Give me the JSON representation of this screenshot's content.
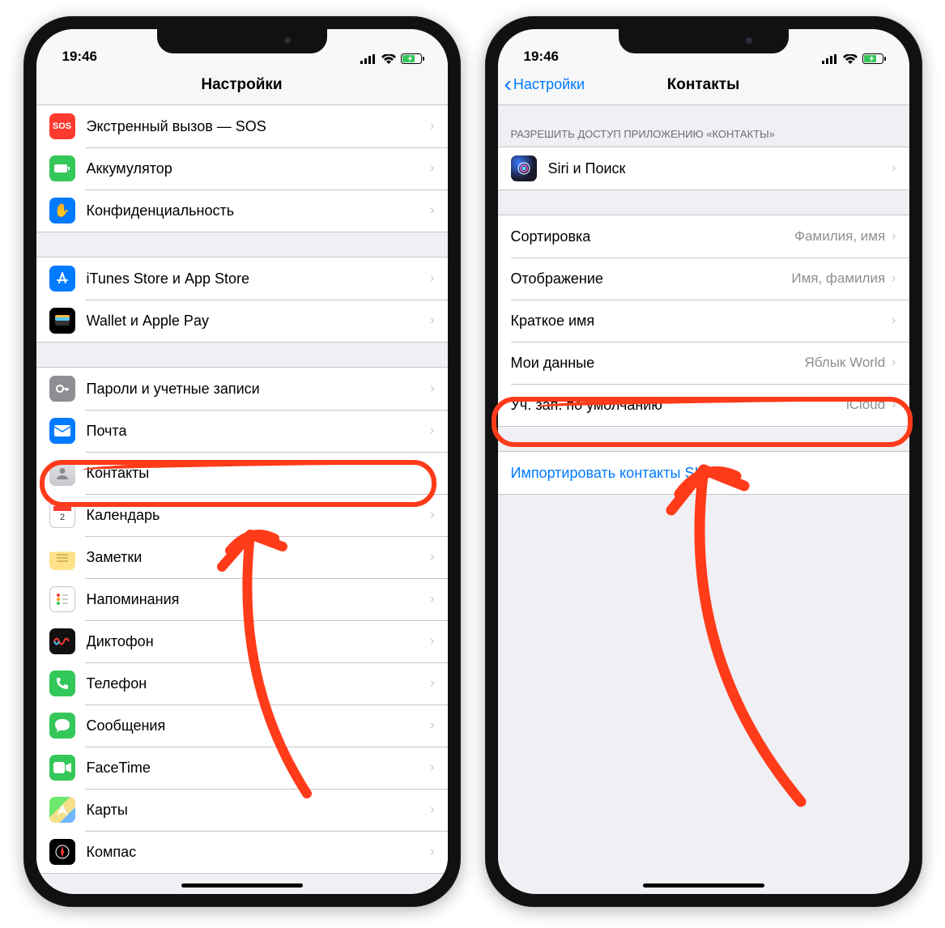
{
  "status": {
    "time": "19:46"
  },
  "left": {
    "title": "Настройки",
    "rows": [
      {
        "icon": "sos-icon",
        "bg": "bg-red",
        "glyph": "SOS",
        "label": "Экстренный вызов — SOS"
      },
      {
        "icon": "battery-app-icon",
        "bg": "bg-green",
        "glyph": "▭",
        "label": "Аккумулятор"
      },
      {
        "icon": "privacy-icon",
        "bg": "bg-blue",
        "glyph": "✋",
        "label": "Конфиденциальность"
      }
    ],
    "rows2": [
      {
        "icon": "appstore-icon",
        "bg": "bg-blue",
        "glyph": "A",
        "label": "iTunes Store и App Store"
      },
      {
        "icon": "wallet-icon",
        "bg": "bg-black",
        "glyph": "▭",
        "label": "Wallet и Apple Pay"
      }
    ],
    "rows3": [
      {
        "icon": "passwords-icon",
        "bg": "bg-gray",
        "glyph": "⚿",
        "label": "Пароли и учетные записи"
      },
      {
        "icon": "mail-icon",
        "bg": "bg-blue",
        "glyph": "✉",
        "label": "Почта"
      },
      {
        "icon": "contacts-icon",
        "bg": "bg-contacts",
        "glyph": "👤",
        "label": "Контакты"
      },
      {
        "icon": "calendar-icon",
        "bg": "bg-white-border",
        "glyph": "📅",
        "label": "Календарь"
      },
      {
        "icon": "notes-icon",
        "bg": "bg-yellow",
        "glyph": "📝",
        "label": "Заметки"
      },
      {
        "icon": "reminders-icon",
        "bg": "bg-white-border",
        "glyph": "⋮",
        "label": "Напоминания"
      },
      {
        "icon": "voice-memos-icon",
        "bg": "bg-voice",
        "glyph": "∿",
        "label": "Диктофон"
      },
      {
        "icon": "phone-icon",
        "bg": "bg-green",
        "glyph": "✆",
        "label": "Телефон"
      },
      {
        "icon": "messages-icon",
        "bg": "bg-green",
        "glyph": "💬",
        "label": "Сообщения"
      },
      {
        "icon": "facetime-icon",
        "bg": "bg-green",
        "glyph": "■",
        "label": "FaceTime"
      },
      {
        "icon": "maps-icon",
        "bg": "bg-maps",
        "glyph": "➤",
        "label": "Карты"
      },
      {
        "icon": "compass-icon",
        "bg": "bg-black",
        "glyph": "✦",
        "label": "Компас"
      }
    ]
  },
  "right": {
    "back": "Настройки",
    "title": "Контакты",
    "section_header": "РАЗРЕШИТЬ ДОСТУП ПРИЛОЖЕНИЮ «КОНТАКТЫ»",
    "siri_row": {
      "label": "Siri и Поиск"
    },
    "rows": [
      {
        "label": "Сортировка",
        "value": "Фамилия, имя"
      },
      {
        "label": "Отображение",
        "value": "Имя, фамилия"
      },
      {
        "label": "Краткое имя",
        "value": ""
      },
      {
        "label": "Мои данные",
        "value": "Яблык World"
      },
      {
        "label": "Уч. зап. по умолчанию",
        "value": "iCloud"
      }
    ],
    "import_label": "Импортировать контакты SIM"
  }
}
